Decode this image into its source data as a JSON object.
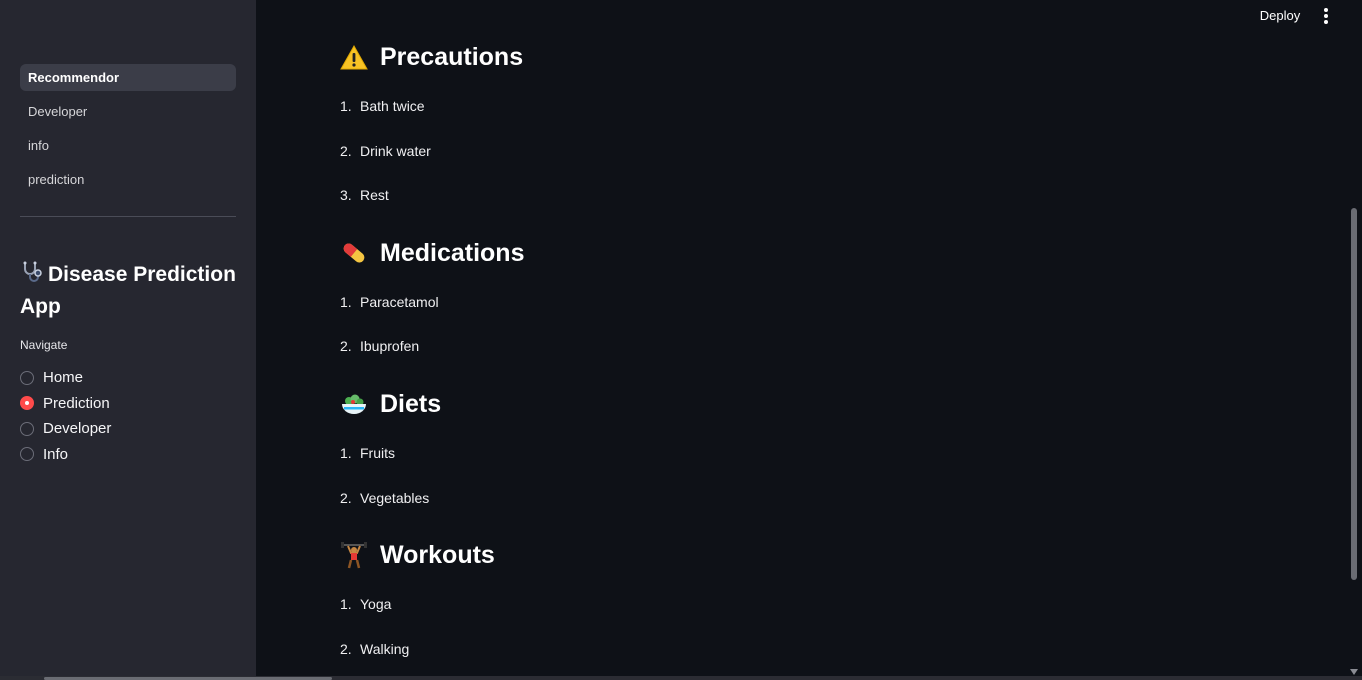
{
  "header": {
    "deploy_label": "Deploy",
    "menu_icon": "more-vertical-icon"
  },
  "sidebar": {
    "pages": [
      {
        "label": "Recommendor",
        "active": true
      },
      {
        "label": "Developer",
        "active": false
      },
      {
        "label": "info",
        "active": false
      },
      {
        "label": "prediction",
        "active": false
      }
    ],
    "app_title_icon": "stethoscope-icon",
    "app_title": "Disease Prediction App",
    "nav_label": "Navigate",
    "nav_options": [
      {
        "label": "Home",
        "checked": false
      },
      {
        "label": "Prediction",
        "checked": true
      },
      {
        "label": "Developer",
        "checked": false
      },
      {
        "label": "Info",
        "checked": false
      }
    ]
  },
  "main": {
    "sections": [
      {
        "icon": "warning-icon",
        "title": "Precautions",
        "items": [
          "Bath twice",
          "Drink water",
          "Rest"
        ]
      },
      {
        "icon": "pill-icon",
        "title": "Medications",
        "items": [
          "Paracetamol",
          "Ibuprofen"
        ]
      },
      {
        "icon": "salad-icon",
        "title": "Diets",
        "items": [
          "Fruits",
          "Vegetables"
        ]
      },
      {
        "icon": "weightlifter-icon",
        "title": "Workouts",
        "items": [
          "Yoga",
          "Walking"
        ]
      }
    ]
  },
  "colors": {
    "background": "#0e1117",
    "sidebar": "#262730",
    "accent": "#ff4b4b"
  }
}
